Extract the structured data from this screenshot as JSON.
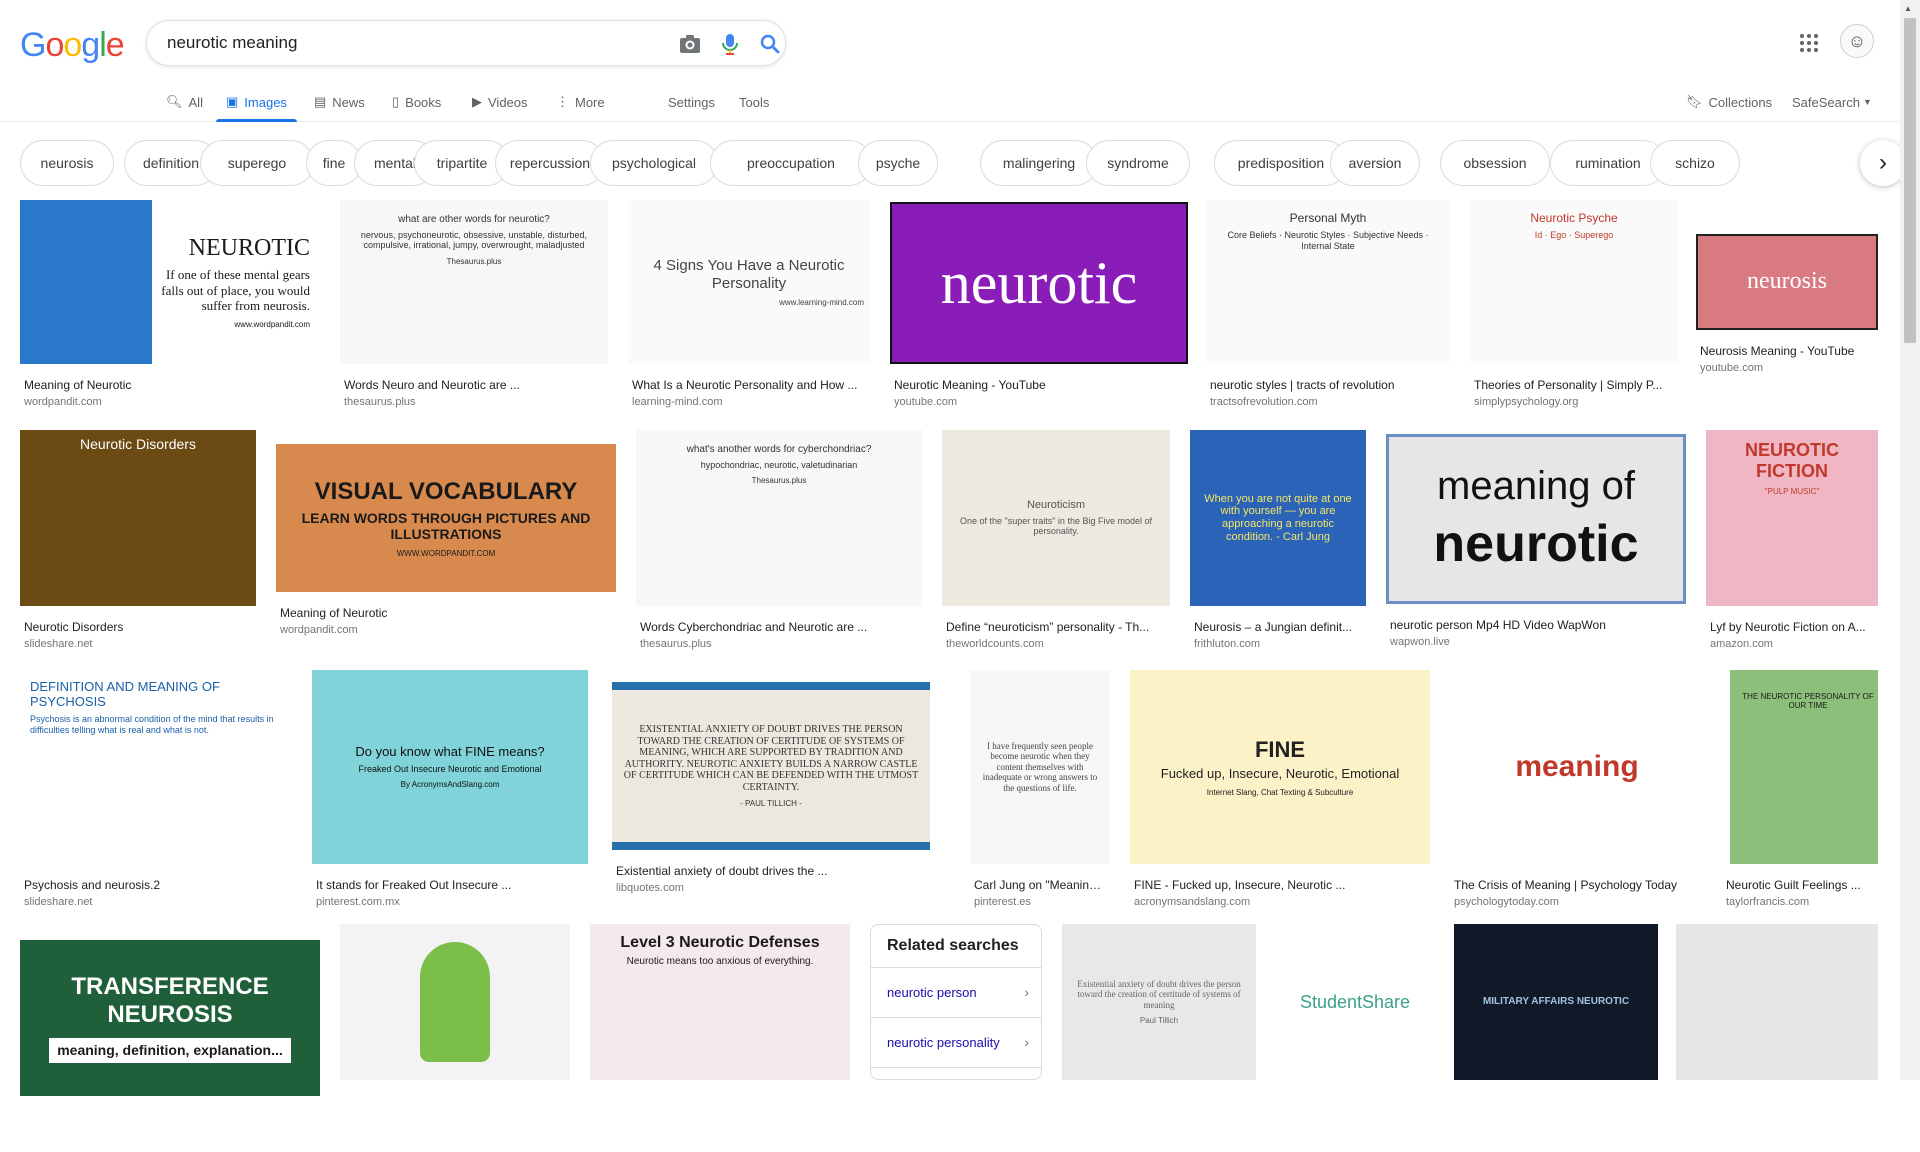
{
  "logo": {
    "text": "Google",
    "letters": [
      "G",
      "o",
      "o",
      "g",
      "l",
      "e"
    ],
    "colors": [
      "#4285F4",
      "#EA4335",
      "#FBBC05",
      "#4285F4",
      "#34A853",
      "#EA4335"
    ]
  },
  "search": {
    "query": "neurotic meaning",
    "icons": [
      "camera-icon",
      "mic-icon",
      "search-icon"
    ]
  },
  "tabs": [
    {
      "label": "All",
      "icon": "search-icon"
    },
    {
      "label": "Images",
      "icon": "image-icon",
      "active": true
    },
    {
      "label": "News",
      "icon": "news-icon"
    },
    {
      "label": "Books",
      "icon": "book-icon"
    },
    {
      "label": "Videos",
      "icon": "video-icon"
    },
    {
      "label": "More",
      "icon": "more-icon"
    },
    {
      "label": "Settings"
    },
    {
      "label": "Tools"
    }
  ],
  "right_tabs": {
    "collections": "Collections",
    "safesearch": "SafeSearch"
  },
  "chips": [
    "neurosis",
    "definition",
    "superego",
    "fine",
    "mental",
    "tripartite",
    "repercussion",
    "psychological",
    "preoccupation",
    "psyche",
    "malingering",
    "syndrome",
    "predisposition",
    "aversion",
    "obsession",
    "rumination",
    "schizo"
  ],
  "results": [
    {
      "title": "Meaning of Neurotic",
      "source": "wordpandit.com",
      "thumb_text": "NEUROTIC",
      "thumb_sub": "If one of these mental gears falls out of place, you would suffer from neurosis.",
      "thumb_foot": "www.wordpandit.com"
    },
    {
      "title": "Words Neuro and Neurotic are ...",
      "source": "thesaurus.plus",
      "thumb_text": "what are other words for neurotic?",
      "thumb_sub": "nervous, psychoneurotic, obsessive, unstable, disturbed, compulsive, irrational, jumpy, overwrought, maladjusted",
      "thumb_foot": "Thesaurus.plus"
    },
    {
      "title": "What Is a Neurotic Personality and How ...",
      "source": "learning-mind.com",
      "thumb_text": "4 Signs You Have a Neurotic Personality",
      "thumb_foot": "www.learning-mind.com"
    },
    {
      "title": "Neurotic Meaning - YouTube",
      "source": "youtube.com",
      "thumb_text": "neurotic"
    },
    {
      "title": "neurotic styles | tracts of revolution",
      "source": "tractsofrevolution.com",
      "thumb_text": "Personal Myth",
      "thumb_sub": "Core Beliefs · Neurotic Styles · Subjective Needs · Internal State"
    },
    {
      "title": "Theories of Personality | Simply P...",
      "source": "simplypsychology.org",
      "thumb_text": "Neurotic Psyche",
      "thumb_sub": "Id · Ego · Superego"
    },
    {
      "title": "Neurosis Meaning - YouTube",
      "source": "youtube.com",
      "thumb_text": "neurosis"
    },
    {
      "title": "Neurotic Disorders",
      "source": "slideshare.net",
      "thumb_text": "Neurotic Disorders"
    },
    {
      "title": "Meaning of Neurotic",
      "source": "wordpandit.com",
      "thumb_text": "VISUAL VOCABULARY",
      "thumb_sub": "LEARN WORDS THROUGH PICTURES AND ILLUSTRATIONS",
      "thumb_foot": "WWW.WORDPANDIT.COM"
    },
    {
      "title": "Words Cyberchondriac and Neurotic are ...",
      "source": "thesaurus.plus",
      "thumb_text": "what's another words for cyberchondriac?",
      "thumb_sub": "hypochondriac, neurotic, valetudinarian",
      "thumb_foot": "Thesaurus.plus"
    },
    {
      "title": "Define “neuroticism” personality - Th...",
      "source": "theworldcounts.com",
      "thumb_text": "Neuroticism",
      "thumb_sub": "One of the \"super traits\" in the Big Five model of personality."
    },
    {
      "title": "Neurosis – a Jungian definit...",
      "source": "frithluton.com",
      "thumb_text": "When you are not quite at one with yourself — you are approaching a neurotic condition. - Carl Jung"
    },
    {
      "title": "neurotic person Mp4 HD Video WapWon",
      "source": "wapwon.live",
      "thumb_text": "meaning of",
      "thumb_sub": "neurotic"
    },
    {
      "title": "Lyf by Neurotic Fiction on A...",
      "source": "amazon.com",
      "thumb_text": "NEUROTIC FICTION",
      "thumb_foot": "\"PULP MUSIC\""
    },
    {
      "title": "Psychosis and neurosis.2",
      "source": "slideshare.net",
      "thumb_text": "DEFINITION AND MEANING OF PSYCHOSIS",
      "thumb_sub": "Psychosis is an abnormal condition of the mind that results in difficulties telling what is real and what is not."
    },
    {
      "title": "It stands for Freaked Out Insecure ...",
      "source": "pinterest.com.mx",
      "thumb_text": "Do you know what FINE means?",
      "thumb_sub": "Freaked Out Insecure Neurotic and Emotional",
      "thumb_foot": "By AcronymsAndSlang.com"
    },
    {
      "title": "Existential anxiety of doubt drives the ...",
      "source": "libquotes.com",
      "thumb_text": "EXISTENTIAL ANXIETY OF DOUBT DRIVES THE PERSON TOWARD THE CREATION OF CERTITUDE OF SYSTEMS OF MEANING, WHICH ARE SUPPORTED BY TRADITION AND AUTHORITY. NEUROTIC ANXIETY BUILDS A NARROW CASTLE OF CERTITUDE WHICH CAN BE DEFENDED WITH THE UTMOST CERTAINTY.",
      "thumb_foot": "- PAUL TILLICH -"
    },
    {
      "title": "Carl Jung on \"Meaning\" ...",
      "source": "pinterest.es",
      "thumb_text": "I have frequently seen people become neurotic when they content themselves with inadequate or wrong answers to the questions of life."
    },
    {
      "title": "FINE - Fucked up, Insecure, Neurotic ...",
      "source": "acronymsandslang.com",
      "thumb_text": "FINE",
      "thumb_sub": "Fucked up, Insecure, Neurotic, Emotional",
      "thumb_foot": "Internet Slang, Chat Texting & Subculture"
    },
    {
      "title": "The Crisis of Meaning | Psychology Today",
      "source": "psychologytoday.com",
      "thumb_text": "meaning"
    },
    {
      "title": "Neurotic Guilt Feelings ...",
      "source": "taylorfrancis.com",
      "thumb_text": "THE NEUROTIC PERSONALITY OF OUR TIME"
    },
    {
      "title": "",
      "source": "",
      "thumb_text": "TRANSFERENCE NEUROSIS",
      "thumb_sub": "meaning, definition, explanation..."
    },
    {
      "title": "",
      "source": "",
      "thumb_text": ""
    },
    {
      "title": "",
      "source": "",
      "thumb_text": "Level 3 Neurotic Defenses",
      "thumb_sub": "Neurotic means too anxious of everything."
    },
    {
      "title": "",
      "source": "",
      "thumb_text": "Existential anxiety of doubt drives the person toward the creation of certitude of systems of meaning",
      "thumb_foot": "Paul Tillich"
    },
    {
      "title": "",
      "source": "",
      "thumb_text": "StudentShare"
    },
    {
      "title": "",
      "source": "",
      "thumb_text": "MILITARY AFFAIRS NEUROTIC"
    },
    {
      "title": "",
      "source": "",
      "thumb_text": ""
    }
  ],
  "related": {
    "title": "Related searches",
    "items": [
      "neurotic person",
      "neurotic personality"
    ]
  }
}
